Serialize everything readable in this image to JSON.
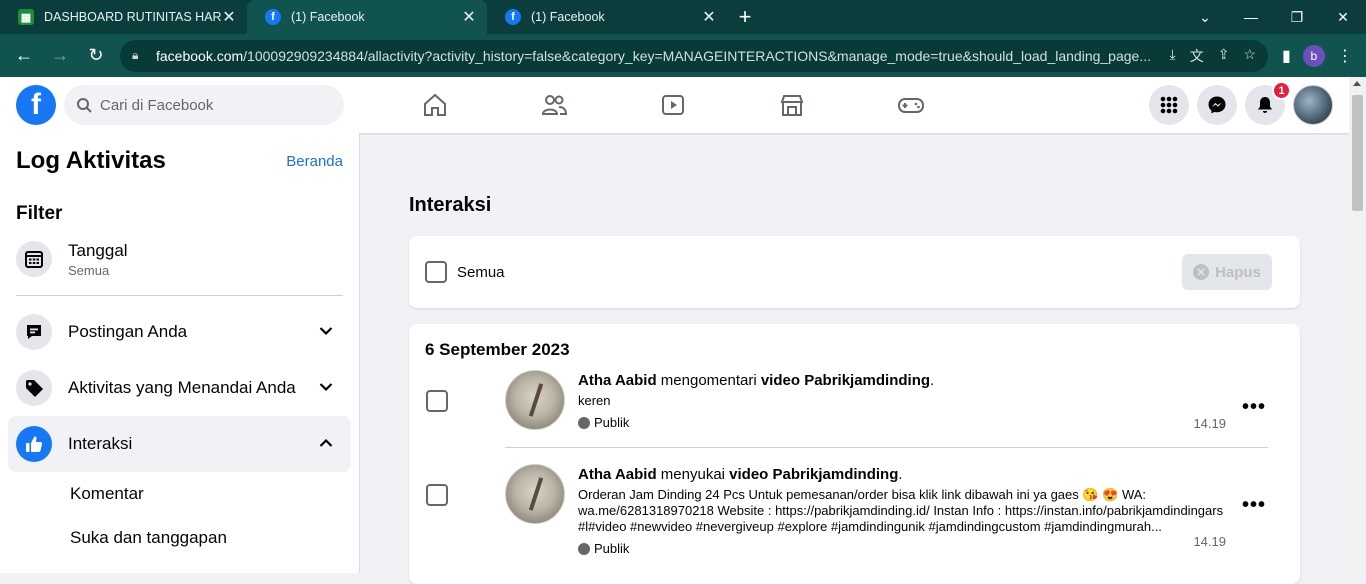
{
  "browser": {
    "tabs": [
      {
        "label": "DASHBOARD RUTINITAS HARIAN",
        "favicon": "sheets"
      },
      {
        "label": "(1) Facebook",
        "favicon": "facebook"
      },
      {
        "label": "(1) Facebook",
        "favicon": "facebook"
      }
    ],
    "url_host": "facebook.com",
    "url_path": "/100092909234884/allactivity?activity_history=false&category_key=MANAGEINTERACTIONS&manage_mode=true&should_load_landing_page...",
    "profile_initial": "b"
  },
  "fbnav": {
    "logo": "f",
    "search_placeholder": "Cari di Facebook",
    "notification_count": "1",
    "accent": "#1877f2"
  },
  "sidebar": {
    "title": "Log Aktivitas",
    "home_link": "Beranda",
    "filter_heading": "Filter",
    "date_filter": {
      "label": "Tanggal",
      "value": "Semua"
    },
    "sections": [
      {
        "label": "Postingan Anda",
        "expanded": false
      },
      {
        "label": "Aktivitas yang Menandai Anda",
        "expanded": false
      },
      {
        "label": "Interaksi",
        "expanded": true
      }
    ],
    "subitems": [
      "Komentar",
      "Suka dan tanggapan"
    ]
  },
  "main": {
    "title": "Interaksi",
    "select_all_label": "Semua",
    "delete_label": "Hapus",
    "date_header": "6 September 2023",
    "entries": [
      {
        "actor": "Atha Aabid",
        "action": " mengomentari ",
        "object": "video Pabrikjamdinding",
        "suffix": ".",
        "text": "keren",
        "privacy": "Publik",
        "time": "14.19"
      },
      {
        "actor": "Atha Aabid",
        "action": " menyukai ",
        "object": "video Pabrikjamdinding",
        "suffix": ".",
        "text": "Orderan Jam Dinding 24 Pcs Untuk pemesanan/order bisa klik link dibawah ini ya gaes 😘 😍 WA: wa.me/6281318970218 Website : https://pabrikjamdinding.id/ Instan Info : https://instan.info/pabrikjamdindingars #l#video #newvideo #nevergiveup #explore #jamdindingunik #jamdindingcustom #jamdindingmurah...",
        "privacy": "Publik",
        "time": "14.19"
      }
    ]
  }
}
